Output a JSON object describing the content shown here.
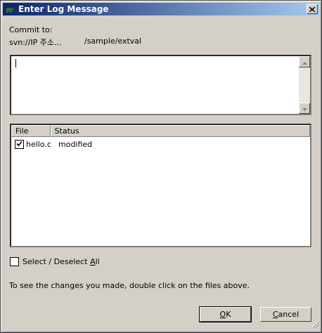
{
  "window": {
    "title": "Enter Log Message"
  },
  "commit": {
    "label": "Commit to:",
    "url_prefix": "svn://IP 주소...",
    "url_path": "/sample/extval"
  },
  "message": {
    "value": ""
  },
  "list": {
    "columns": [
      "File",
      "Status"
    ],
    "rows": [
      {
        "file": "hello.c",
        "status": "modified",
        "checked": true
      }
    ]
  },
  "select_all": {
    "label_prefix": "Select / Deselect ",
    "label_accel": "A",
    "label_suffix": "ll",
    "checked": false
  },
  "hint": "To see the changes you made, double click on the files above.",
  "buttons": {
    "ok_accel": "O",
    "ok_rest": "K",
    "cancel_accel": "C",
    "cancel_rest": "ancel"
  }
}
